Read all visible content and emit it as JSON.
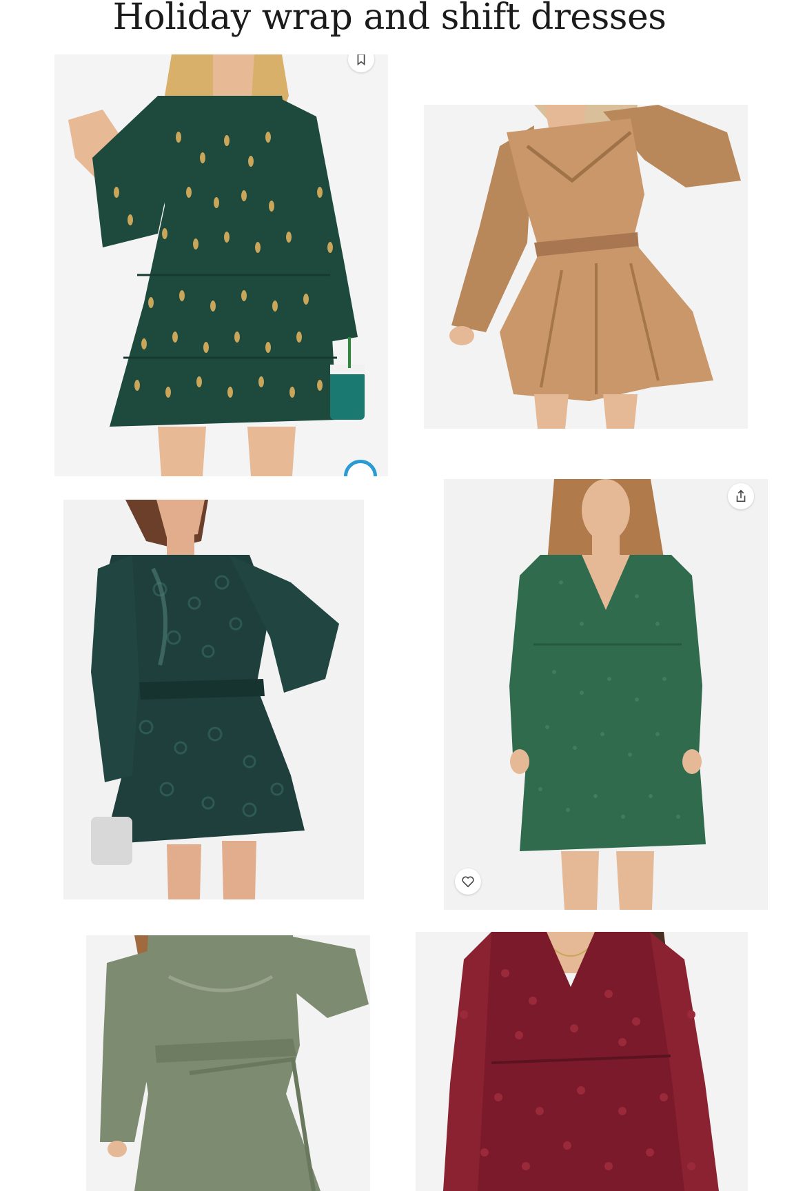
{
  "page": {
    "title": "Holiday wrap and shift dresses"
  },
  "products": [
    {
      "description": "Green dress with gold dots",
      "dress_color": "#1d4a3c",
      "accent_color": "#c9a65a",
      "background": "#f4f4f4"
    },
    {
      "description": "Caramel satin wrap dress",
      "dress_color": "#b8875a",
      "accent_color": "#d7a877",
      "background": "#f3f3f3"
    },
    {
      "description": "Dark green satin leopard belted dress",
      "dress_color": "#1e3f3b",
      "accent_color": "#2f5a54",
      "background": "#f2f2f2"
    },
    {
      "description": "Green swiss dot shift dress",
      "dress_color": "#2f6b4c",
      "accent_color": "#3f7d5c",
      "background": "#f2f2f2"
    },
    {
      "description": "Sage satin wrap dress",
      "dress_color": "#7d8c70",
      "accent_color": "#97a38a",
      "background": "#f3f3f3"
    },
    {
      "description": "Burgundy swiss dot dress",
      "dress_color": "#7a1a2a",
      "accent_color": "#9a2a3a",
      "background": "#f3f3f3"
    }
  ],
  "icons": {
    "share": "share-icon",
    "favorite": "heart-icon",
    "save": "bookmark-icon"
  }
}
